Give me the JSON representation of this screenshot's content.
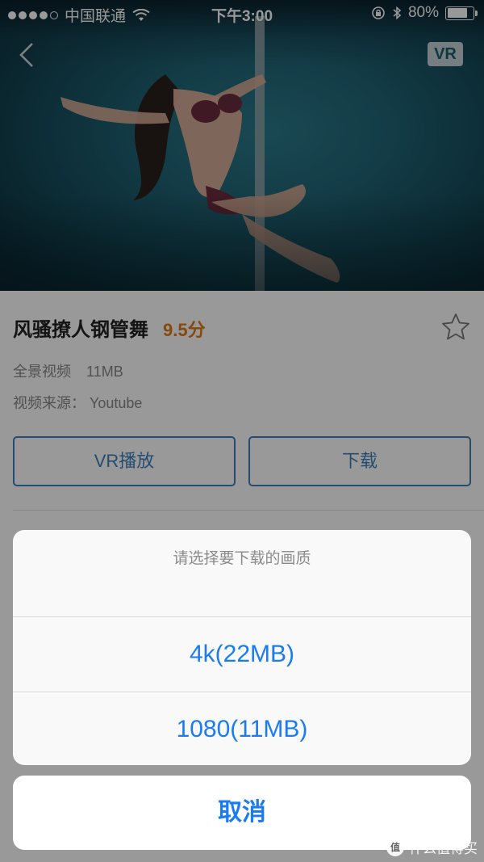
{
  "status_bar": {
    "carrier": "中国联通",
    "time": "下午3:00",
    "battery": "80%",
    "battery_level": 0.8,
    "signal_bars_filled": 4,
    "signal_bars_total": 5
  },
  "header": {
    "back_icon": "chevron-left-icon",
    "vr_badge": "VR"
  },
  "video": {
    "title": "风骚撩人钢管舞",
    "score": "9.5分",
    "type_label": "全景视频",
    "size": "11MB",
    "source_label": "视频来源：",
    "source": "Youtube",
    "favorite_icon": "star-outline-icon"
  },
  "actions": {
    "play_label": "VR播放",
    "download_label": "下载"
  },
  "download_sheet": {
    "title": "请选择要下载的画质",
    "options": [
      "4k(22MB)",
      "1080(11MB)"
    ],
    "cancel_label": "取消"
  },
  "watermark": {
    "badge": "值",
    "text": "什么值得买"
  },
  "colors": {
    "accent_blue": "#3f7fb7",
    "ios_blue": "#1a7cf0",
    "score_orange": "#e07a17"
  }
}
